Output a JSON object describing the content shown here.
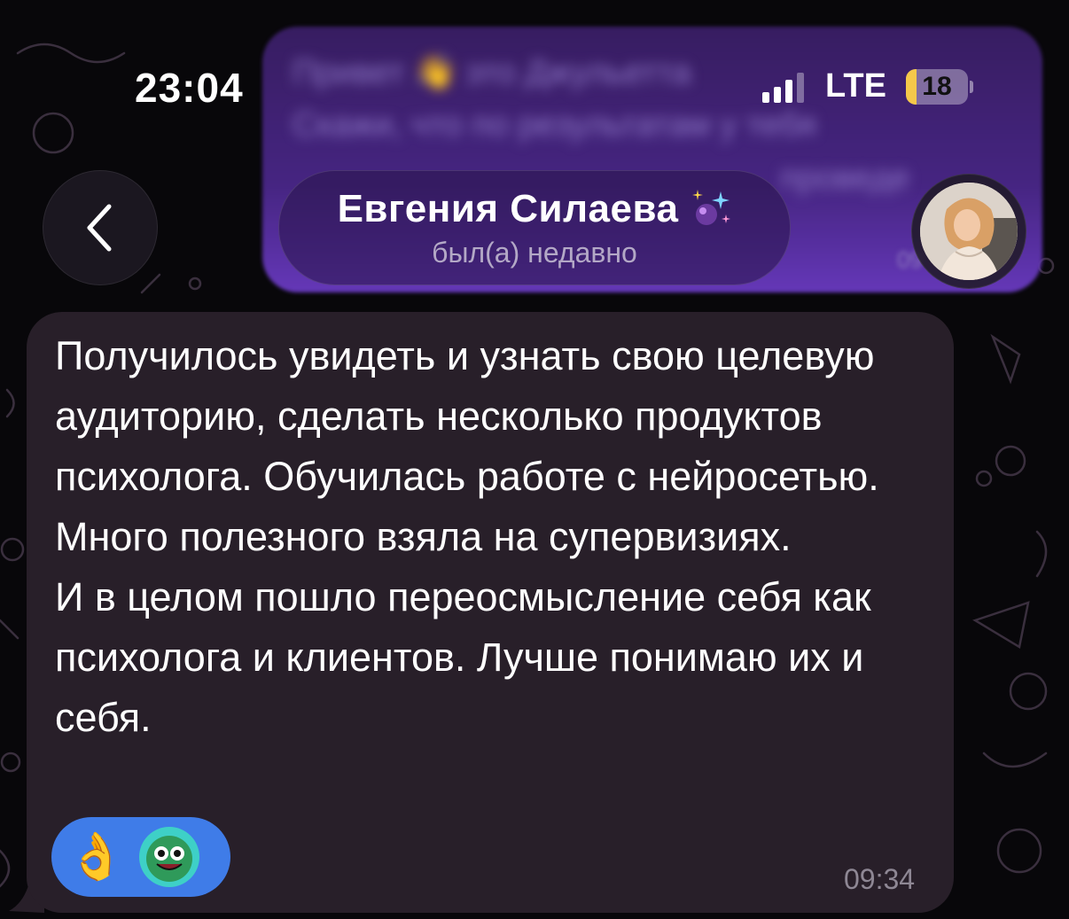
{
  "status_bar": {
    "time": "23:04",
    "network": "LTE",
    "battery_level": "18",
    "signal_bars_active": 3
  },
  "background_message": {
    "line1": "Привет 👋 это Джульетта",
    "line2": "Скажи, что по результатам у тебя",
    "line3": "проведе",
    "time": "09"
  },
  "header": {
    "back_icon": "chevron-left-icon",
    "contact_name": "Евгения Силаева",
    "name_emoji_icon": "sparkles-icon",
    "last_seen": "был(а) недавно"
  },
  "message": {
    "paragraphs": [
      "Получилось увидеть и узнать свою целевую аудиторию, сделать несколько продуктов психолога. Обучилась работе с нейросетью.",
      "Много полезного взяла на супервизиях.",
      "И в целом пошло переосмысление себя как психолога и клиентов. Лучше понимаю их и себя."
    ],
    "time": "09:34",
    "reactions": [
      {
        "icon": "ok-hand-icon",
        "glyph": "👌"
      },
      {
        "icon": "frog-sticker-icon"
      }
    ]
  },
  "colors": {
    "bubble": "#281f29",
    "reaction_bg": "#3f7ce8",
    "header_purple": "#4a2789"
  }
}
